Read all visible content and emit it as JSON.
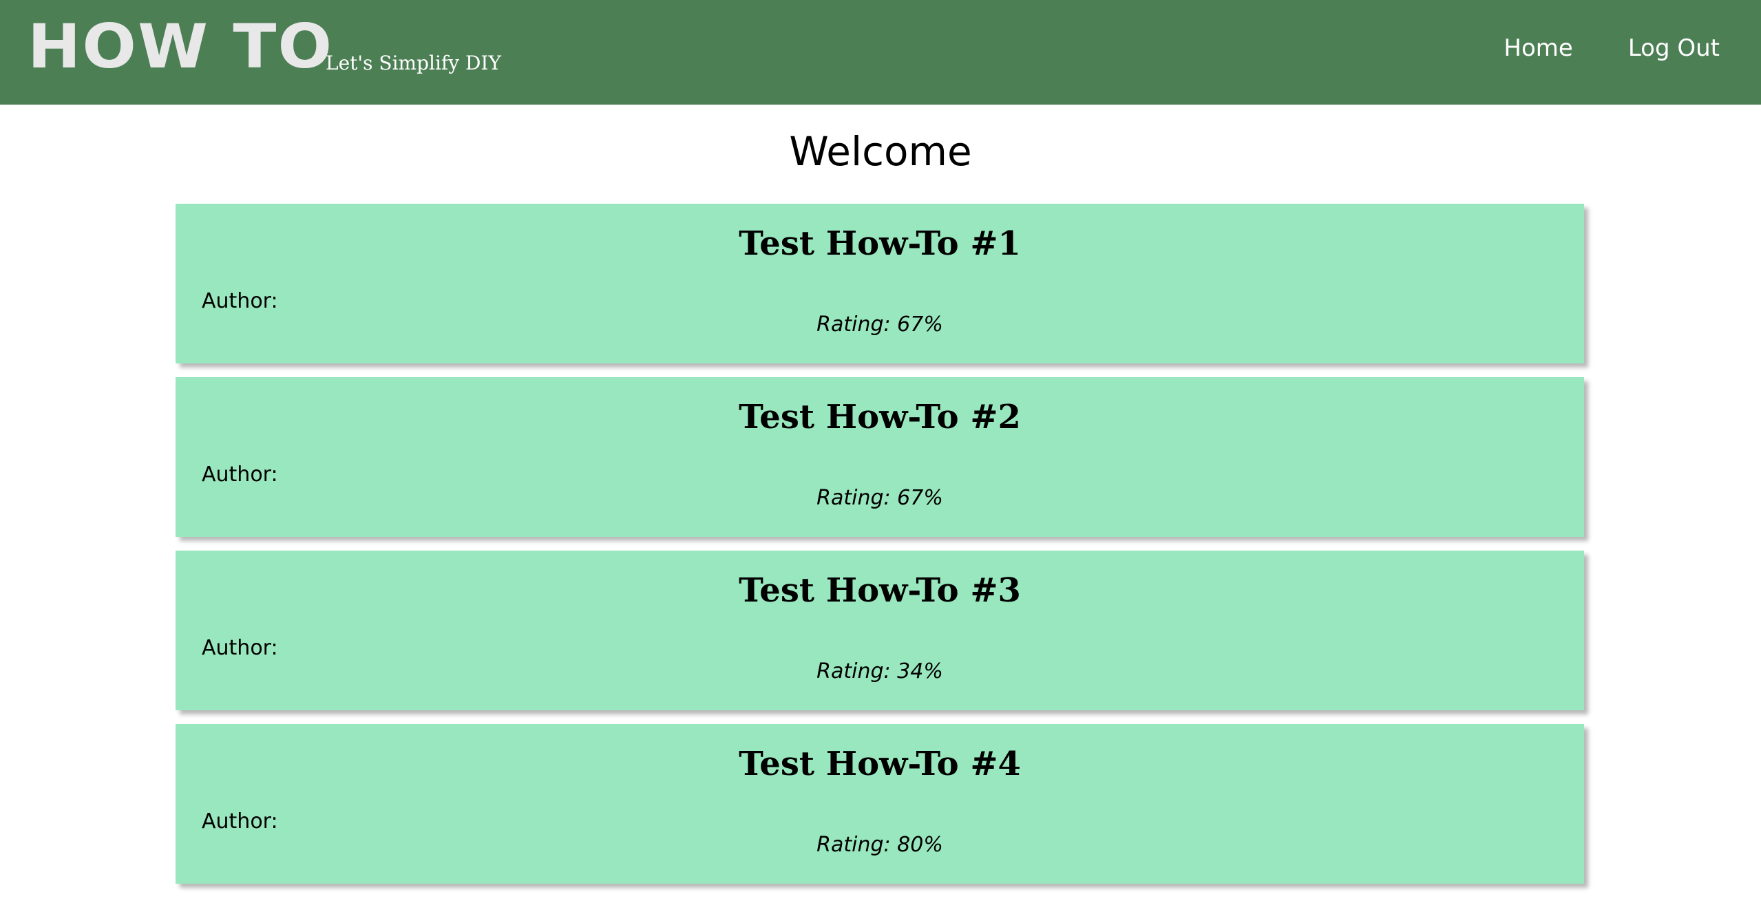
{
  "header": {
    "logo": "HOW TO",
    "tagline": "Let's Simplify DIY",
    "nav": [
      {
        "label": "Home"
      },
      {
        "label": "Log Out"
      }
    ],
    "background_color": "#4d7f55"
  },
  "main": {
    "heading": "Welcome",
    "card_color": "#99e7be",
    "cards": [
      {
        "title": "Test How-To #1",
        "author": "Author:",
        "rating": "Rating: 67%"
      },
      {
        "title": "Test How-To #2",
        "author": "Author:",
        "rating": "Rating: 67%"
      },
      {
        "title": "Test How-To #3",
        "author": "Author:",
        "rating": "Rating: 34%"
      },
      {
        "title": "Test How-To #4",
        "author": "Author:",
        "rating": "Rating: 80%"
      }
    ]
  }
}
